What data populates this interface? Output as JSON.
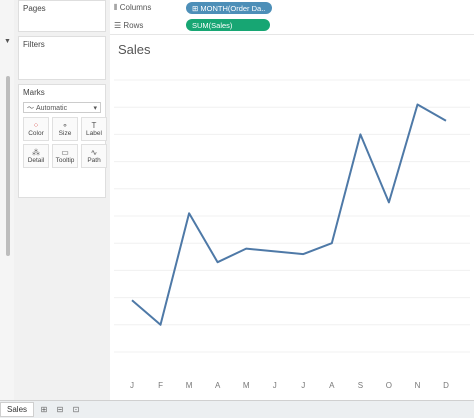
{
  "sidebar": {
    "pages_title": "Pages",
    "filters_title": "Filters",
    "marks_title": "Marks",
    "marks_type": "Automatic",
    "mark_buttons": [
      {
        "label": "Color",
        "icon": "color-dots-icon"
      },
      {
        "label": "Size",
        "icon": "size-icon"
      },
      {
        "label": "Label",
        "icon": "label-icon"
      },
      {
        "label": "Detail",
        "icon": "detail-icon"
      },
      {
        "label": "Tooltip",
        "icon": "tooltip-icon"
      },
      {
        "label": "Path",
        "icon": "path-icon"
      }
    ]
  },
  "shelves": {
    "columns_label": "Columns",
    "columns_pill": "MONTH(Order Da..",
    "rows_label": "Rows",
    "rows_pill": "SUM(Sales)"
  },
  "colors": {
    "line": "#4e79a7",
    "dimension_pill": "#4d8fb8",
    "measure_pill": "#17a673"
  },
  "chart_data": {
    "type": "line",
    "title": "Sales",
    "categories": [
      "J",
      "F",
      "M",
      "A",
      "M",
      "J",
      "J",
      "A",
      "S",
      "O",
      "N",
      "D"
    ],
    "values": [
      95,
      50,
      255,
      165,
      190,
      185,
      180,
      200,
      400,
      275,
      455,
      425
    ],
    "ylim": [
      0,
      500
    ],
    "grid": true
  },
  "footer": {
    "sheet_tab": "Sales"
  }
}
